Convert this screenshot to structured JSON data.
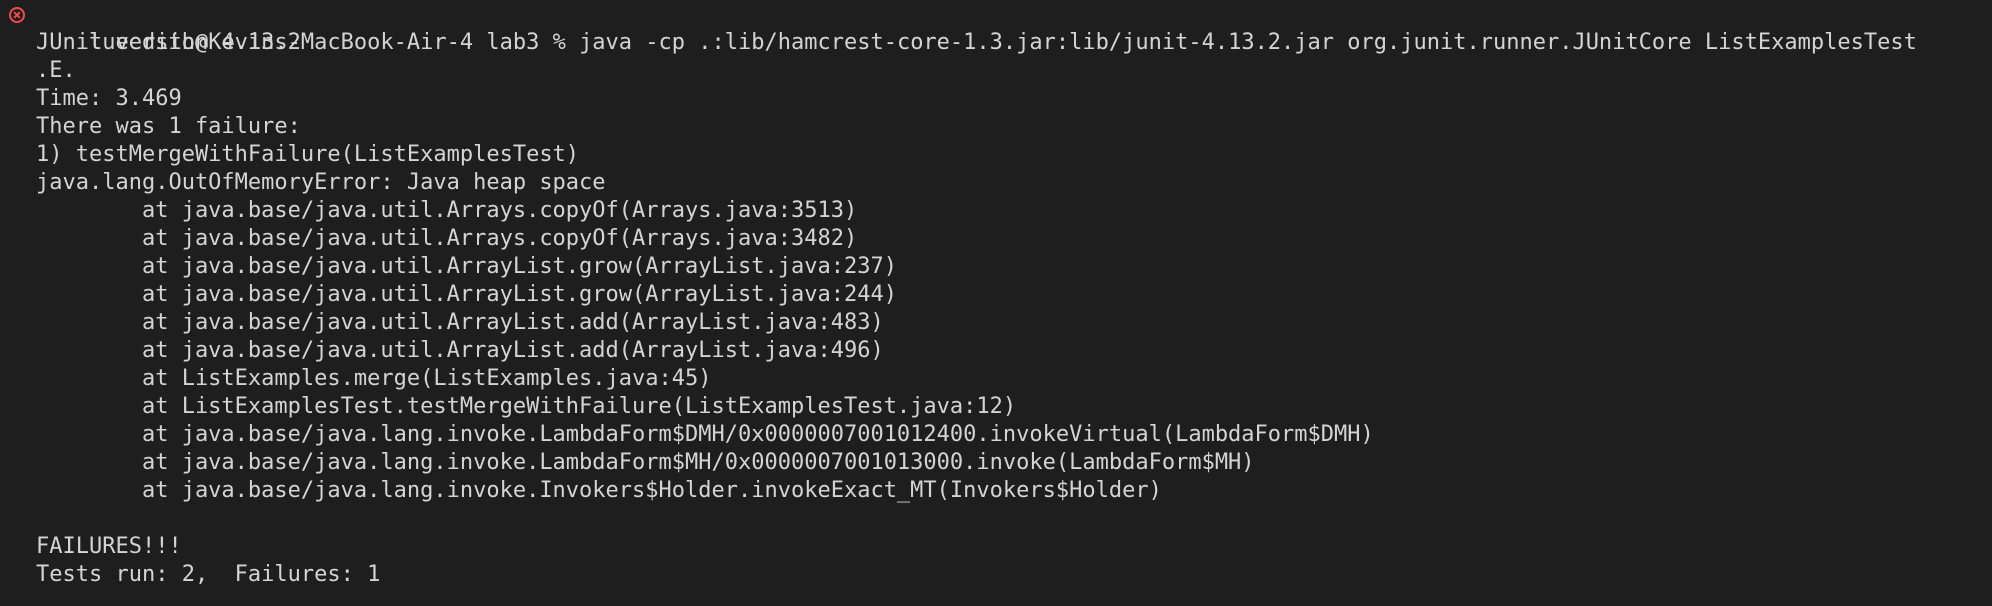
{
  "terminal": {
    "status_icon": "error-circle-icon",
    "status_color": "#f14c4c",
    "background_color": "#1e1e1e",
    "text_color": "#d4d4d4",
    "prompt": "lueedith@Kevins-MacBook-Air-4 lab3 % ",
    "command": "java -cp .:lib/hamcrest-core-1.3.jar:lib/junit-4.13.2.jar org.junit.runner.JUnitCore ListExamplesTest",
    "output": {
      "version": "JUnit version 4.13.2",
      "progress": ".E.",
      "time": "Time: 3.469",
      "failure_header": "There was 1 failure:",
      "failure_title": "1) testMergeWithFailure(ListExamplesTest)",
      "exception": "java.lang.OutOfMemoryError: Java heap space",
      "stack": [
        "        at java.base/java.util.Arrays.copyOf(Arrays.java:3513)",
        "        at java.base/java.util.Arrays.copyOf(Arrays.java:3482)",
        "        at java.base/java.util.ArrayList.grow(ArrayList.java:237)",
        "        at java.base/java.util.ArrayList.grow(ArrayList.java:244)",
        "        at java.base/java.util.ArrayList.add(ArrayList.java:483)",
        "        at java.base/java.util.ArrayList.add(ArrayList.java:496)",
        "        at ListExamples.merge(ListExamples.java:45)",
        "        at ListExamplesTest.testMergeWithFailure(ListExamplesTest.java:12)",
        "        at java.base/java.lang.invoke.LambdaForm$DMH/0x0000007001012400.invokeVirtual(LambdaForm$DMH)",
        "        at java.base/java.lang.invoke.LambdaForm$MH/0x0000007001013000.invoke(LambdaForm$MH)",
        "        at java.base/java.lang.invoke.Invokers$Holder.invokeExact_MT(Invokers$Holder)"
      ],
      "summary": "FAILURES!!!",
      "tests_summary": "Tests run: 2,  Failures: 1"
    }
  }
}
